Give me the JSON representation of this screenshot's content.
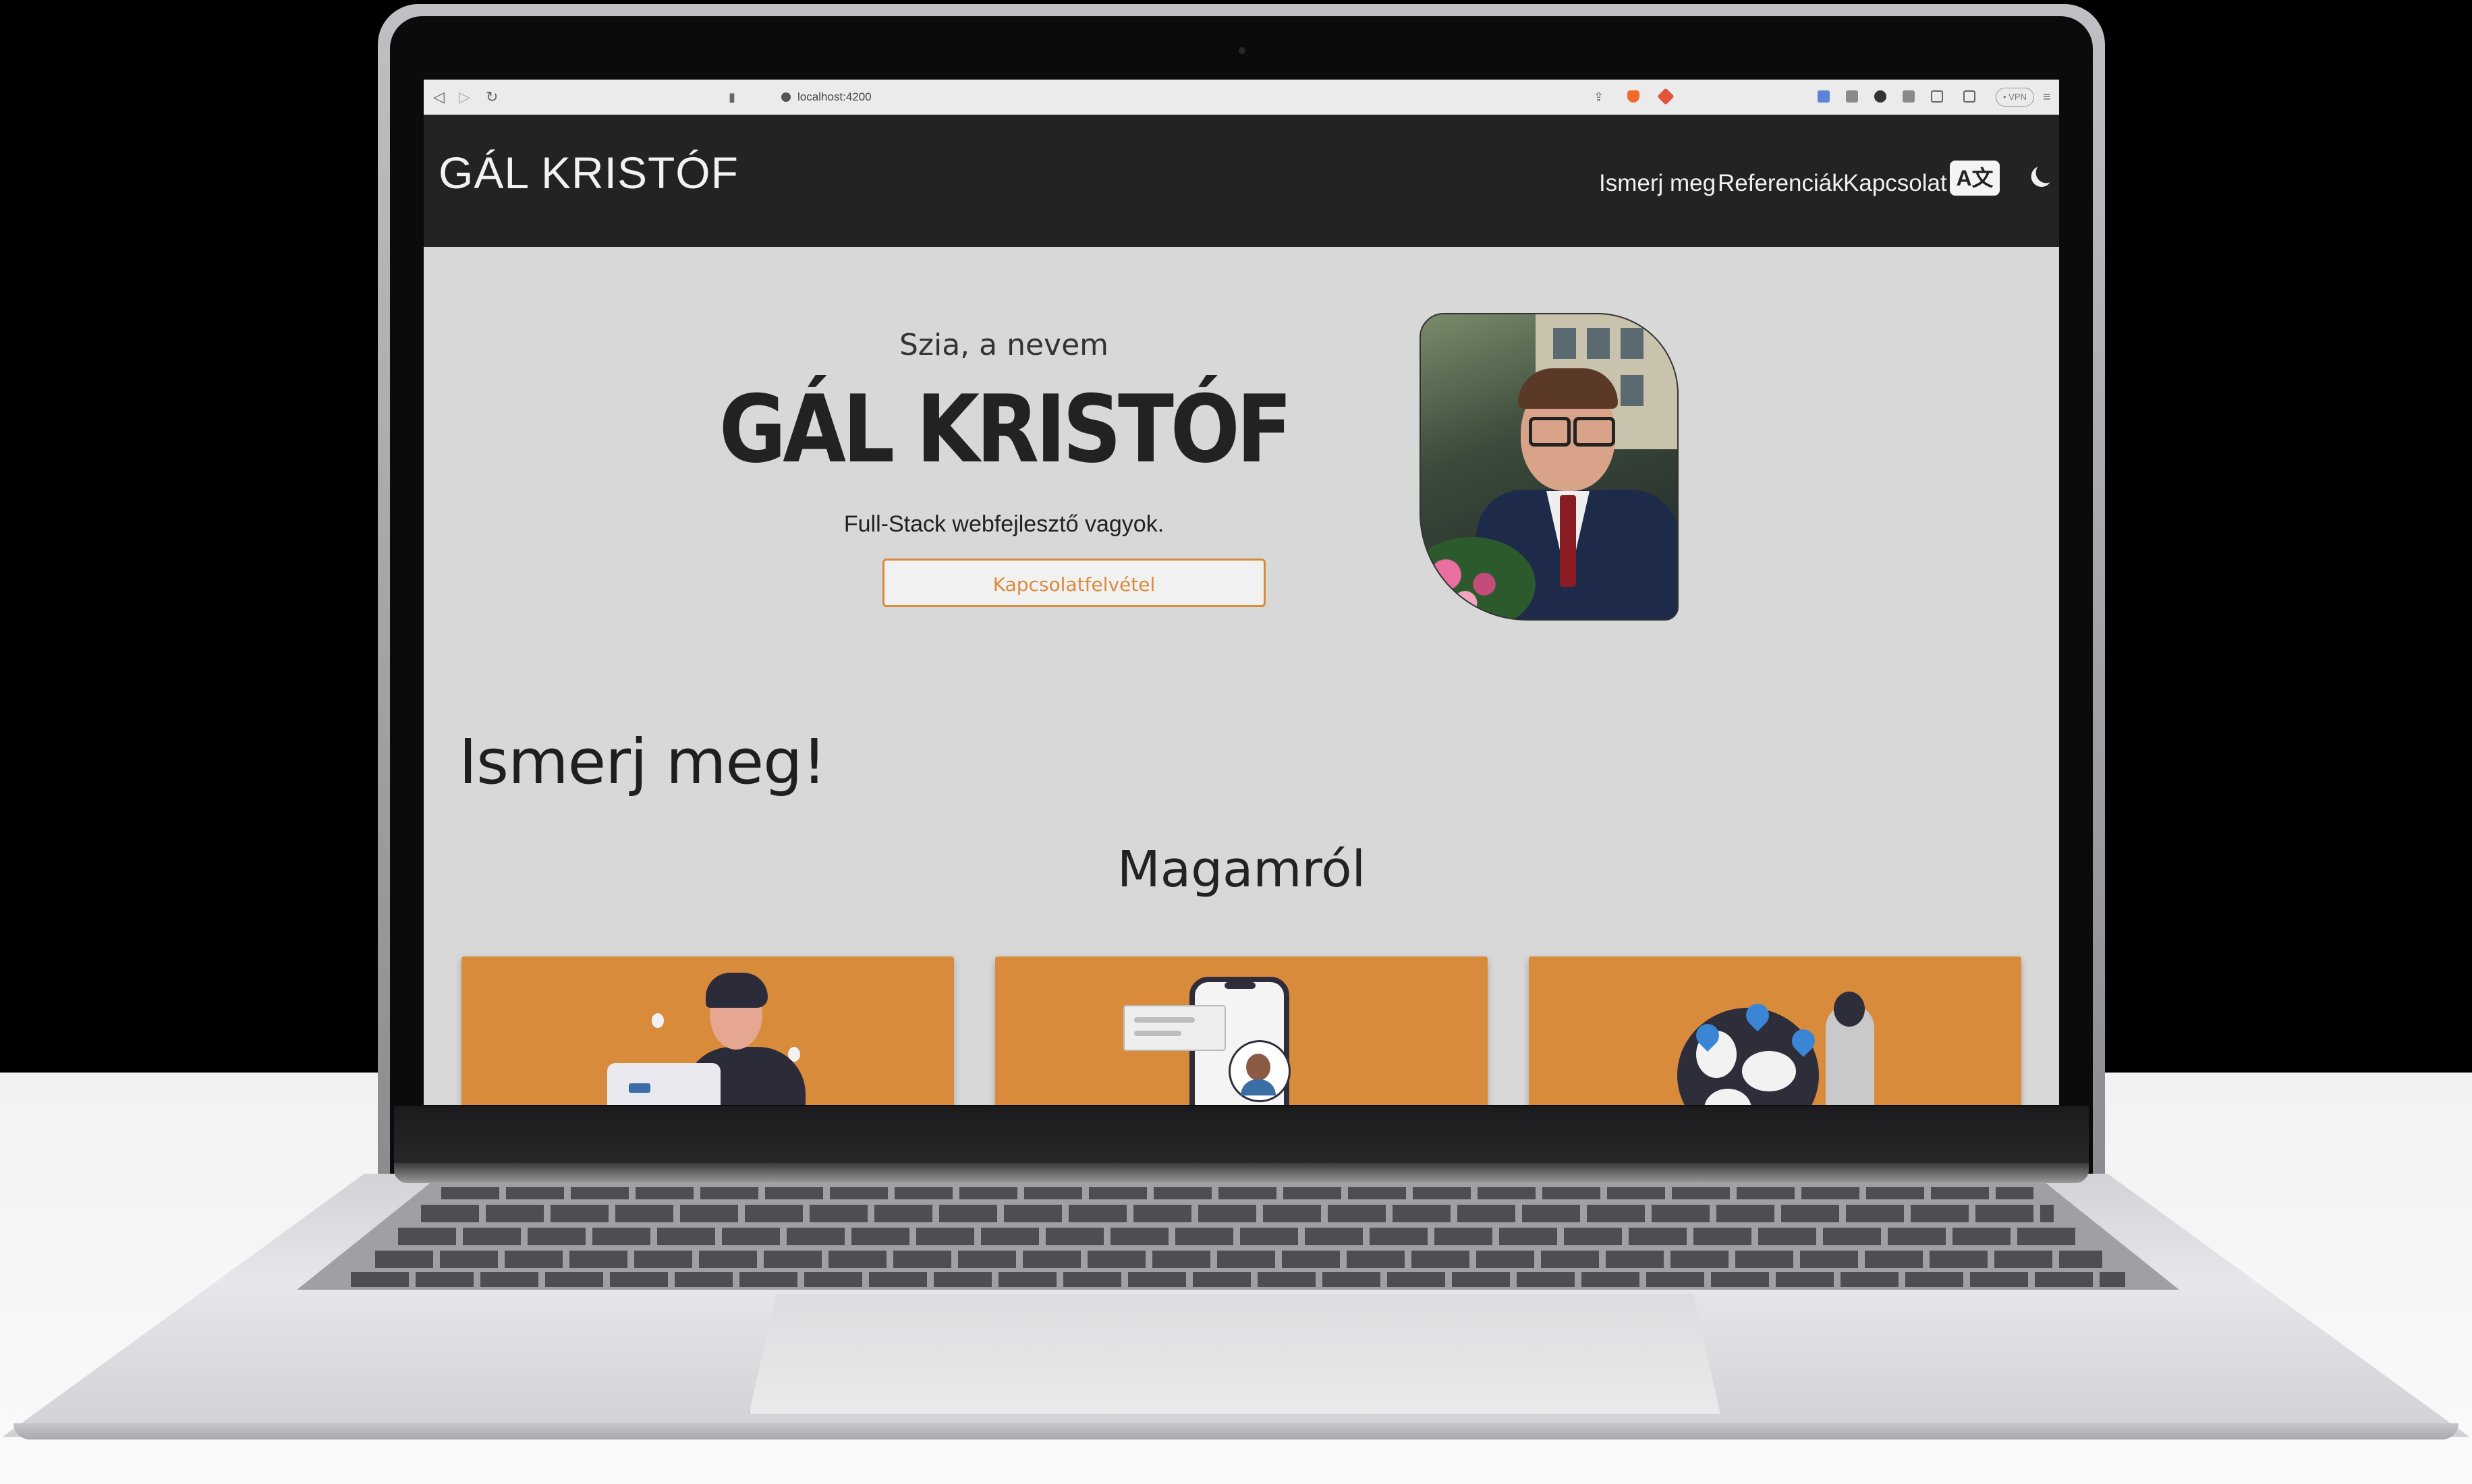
{
  "browser": {
    "url": "localhost:4200",
    "vpn_label": "• VPN"
  },
  "site": {
    "brand": "GÁL KRISTÓF",
    "nav": [
      "Ismerj meg",
      "Referenciák",
      "Kapcsolat"
    ],
    "lang_button": "A文"
  },
  "hero": {
    "greeting": "Szia, a nevem",
    "name": "GÁL KRISTÓF",
    "subtitle": "Full-Stack webfejlesztő vagyok.",
    "cta": "Kapcsolatfelvétel"
  },
  "sections": {
    "intro_title": "Ismerj meg!",
    "about_title": "Magamról"
  },
  "colors": {
    "accent": "#d98b3c",
    "navbar": "#232323",
    "page_bg": "#d8d8d8"
  }
}
